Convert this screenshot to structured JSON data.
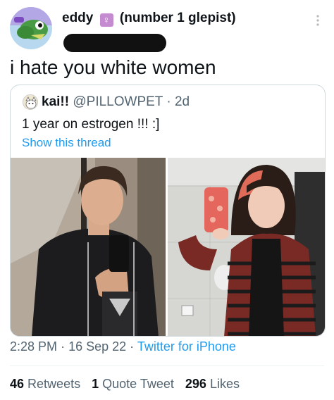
{
  "tweet": {
    "author_name": "eddy",
    "author_name_suffix": "(number 1 glepist)",
    "name_emoji": "♀",
    "text": "i hate you white women"
  },
  "quote": {
    "name": "kai!!",
    "handle": "@PILLOWPET",
    "separator": "·",
    "age": "2d",
    "text": "1 year on estrogen !!! :]",
    "show_thread": "Show this thread"
  },
  "meta": {
    "time": "2:28 PM",
    "dot1": "·",
    "date": "16 Sep 22",
    "dot2": "·",
    "source": "Twitter for iPhone"
  },
  "stats": {
    "retweets_count": "46",
    "retweets_label": "Retweets",
    "quotes_count": "1",
    "quotes_label": "Quote Tweet",
    "likes_count": "296",
    "likes_label": "Likes"
  },
  "colors": {
    "link": "#1d9bf0",
    "secondary_text": "#536471",
    "primary_text": "#0f1419"
  }
}
